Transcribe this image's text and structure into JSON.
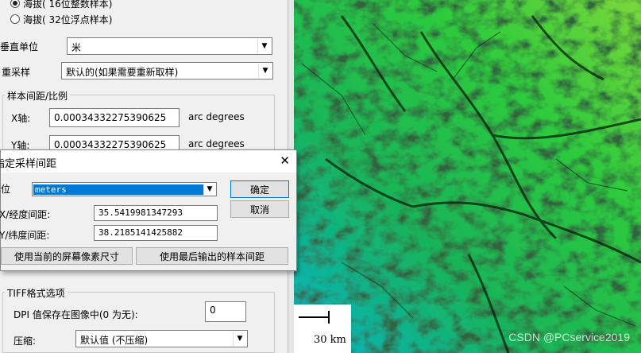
{
  "export_panel": {
    "pixel_type": {
      "option_int16": "海拔( 16位整数样本)",
      "option_float32": "海拔( 32位浮点样本)",
      "selected": "option_int16"
    },
    "vertical_unit": {
      "label": "垂直单位",
      "value": "米"
    },
    "resampling": {
      "label": "重采样",
      "value": "默认的(如果需要重新取样)"
    },
    "sample_spacing": {
      "title": "样本间距/比例",
      "x_label": "X轴:",
      "x_value": "0.00034332275390625",
      "x_unit": "arc degrees",
      "y_label": "Y轴:",
      "y_value": "0.00034332275390625",
      "y_unit": "arc degrees"
    },
    "tiff_options": {
      "title": "TIFF格式选项",
      "dpi_label": "DPI 值保存在图像中(0 为无):",
      "dpi_value": "0",
      "compress_label": "压缩:",
      "compress_value": "默认值 (不压缩)"
    }
  },
  "dialog": {
    "title": "指定采样间距",
    "unit_label": "单位",
    "unit_value": "meters",
    "x_label": "X/经度间距:",
    "x_value": "35.5419981347293",
    "y_label": "Y/纬度间距:",
    "y_value": "38.2185141425882",
    "ok": "确定",
    "cancel": "取消",
    "use_screen": "使用当前的屏幕像素尺寸",
    "use_last": "使用最后输出的样本间距",
    "close_glyph": "✕"
  },
  "map": {
    "scale_label": "30 km",
    "watermark": "CSDN @PCservice2019",
    "colors": {
      "low": "#00b4c8",
      "mid": "#1fbf3a",
      "high": "#8ad83a",
      "shadow": "#0a2a10"
    }
  }
}
